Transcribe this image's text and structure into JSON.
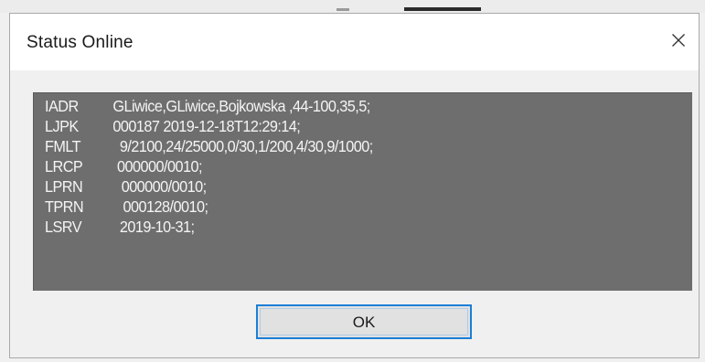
{
  "dialog": {
    "title": "Status Online",
    "close_icon": "close-icon",
    "ok_label": "OK"
  },
  "status_lines": [
    {
      "key": "IADR",
      "value": "GLiwice,GLiwice,Bojkowska ,44-100,35,5;"
    },
    {
      "key": "LJPK",
      "value": "000187 2019-12-18T12:29:14;"
    },
    {
      "key": "FMLT",
      "value": "9/2100,24/25000,0/30,1/200,4/30,9/1000;"
    },
    {
      "key": "LRCP",
      "value": "000000/0010;"
    },
    {
      "key": "LPRN",
      "value": "000000/0010;"
    },
    {
      "key": "TPRN",
      "value": "000128/0010;"
    },
    {
      "key": "LSRV",
      "value": "2019-10-31;"
    }
  ],
  "colors": {
    "content_bg": "#6e6e6e",
    "text": "#f4f4f4",
    "button_border": "#1c7fd6"
  }
}
